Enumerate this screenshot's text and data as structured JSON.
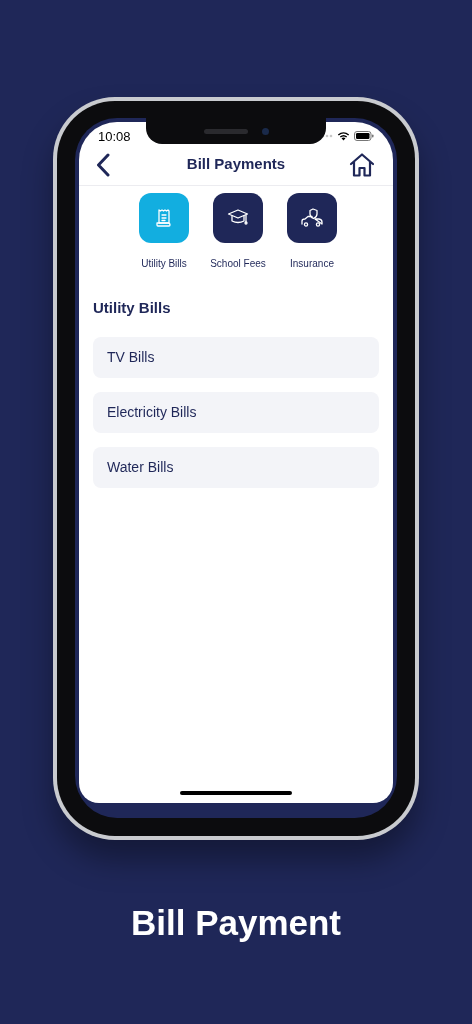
{
  "status_bar": {
    "time": "10:08"
  },
  "header": {
    "title": "Bill Payments"
  },
  "categories": [
    {
      "label": "Utility Bills",
      "kind": "receipt",
      "selected": true
    },
    {
      "label": "School Fees",
      "kind": "graduation",
      "selected": false
    },
    {
      "label": "Insurance",
      "kind": "car",
      "selected": false
    }
  ],
  "section": {
    "title": "Utility Bills"
  },
  "items": [
    {
      "label": "TV Bills"
    },
    {
      "label": "Electricity Bills"
    },
    {
      "label": "Water Bills"
    }
  ],
  "caption": "Bill Payment"
}
